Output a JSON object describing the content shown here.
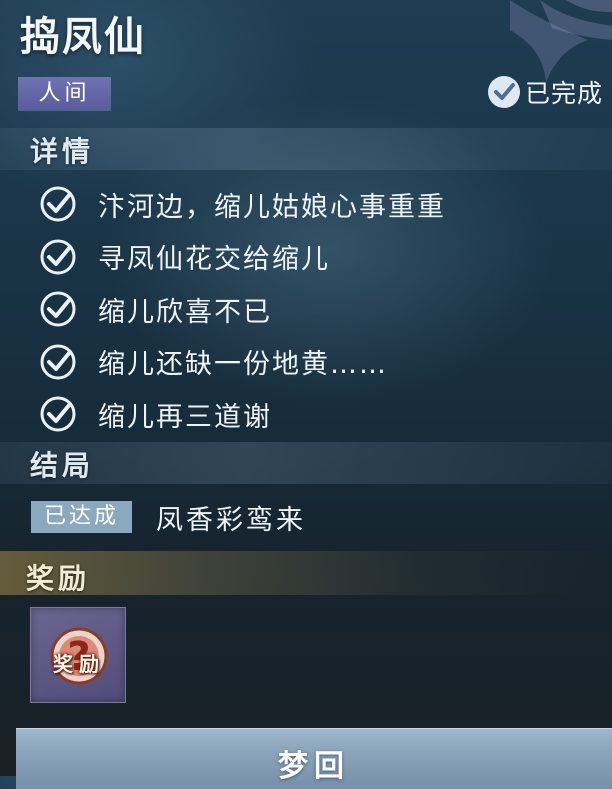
{
  "quest": {
    "title": "捣凤仙",
    "realm_tag": "人间",
    "status": "已完成"
  },
  "details": {
    "heading": "详情",
    "items": [
      {
        "text": "汴河边，缩儿姑娘心事重重",
        "done": true
      },
      {
        "text": "寻凤仙花交给缩儿",
        "done": true
      },
      {
        "text": "缩儿欣喜不已",
        "done": true
      },
      {
        "text": "缩儿还缺一份地黄……",
        "done": true
      },
      {
        "text": "缩儿再三道谢",
        "done": true
      }
    ]
  },
  "ending": {
    "heading": "结局",
    "badge": "已达成",
    "text": "凤香彩鸾来"
  },
  "reward": {
    "heading": "奖励",
    "item_label": "奖励",
    "item_icon": "question-mark-icon"
  },
  "bottom_button": {
    "label": "梦回"
  },
  "colors": {
    "realm_tag": "#6f73b1",
    "achieved_badge": "#8aa9bf",
    "reward_band": "#a58c46",
    "bottom_button": "#89a3ba",
    "check": "#e8f2f8"
  }
}
